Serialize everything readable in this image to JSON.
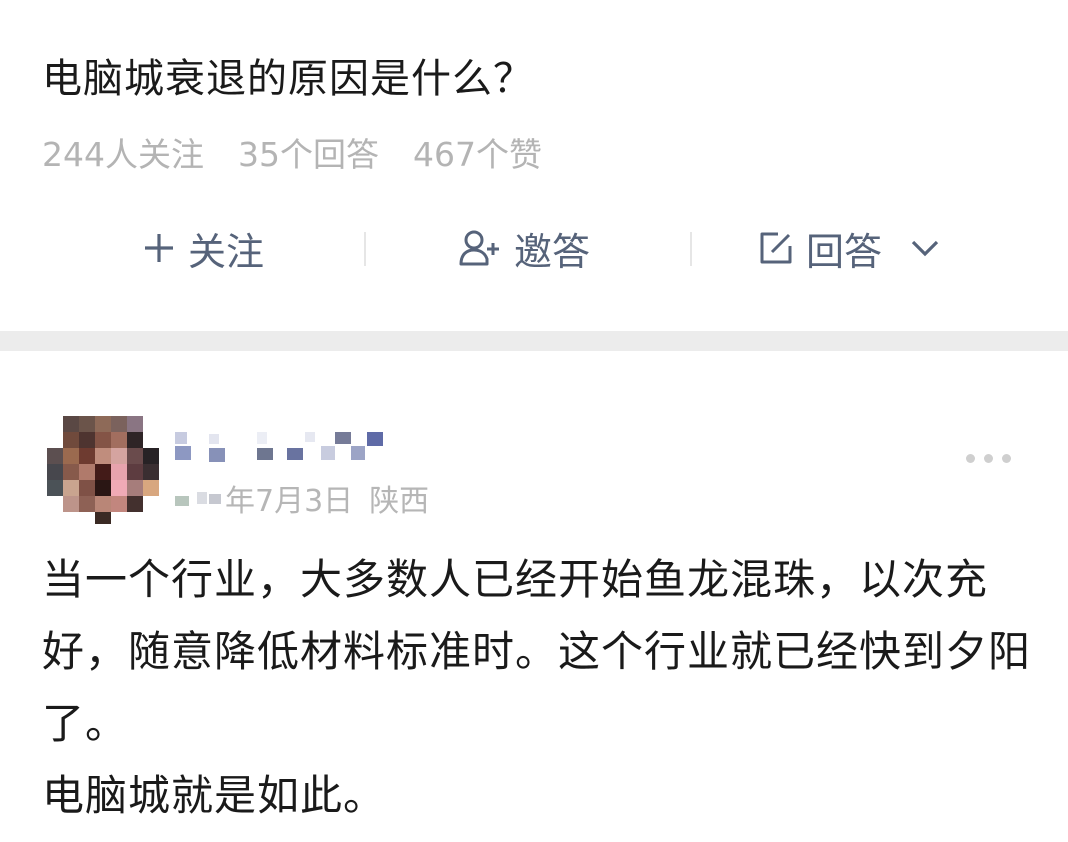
{
  "question": {
    "title": "电脑城衰退的原因是什么？"
  },
  "stats": {
    "followers": "244人关注",
    "answers": "35个回答",
    "likes": "467个赞"
  },
  "actions": {
    "follow_label": "关注",
    "invite_label": "邀答",
    "answer_label": "回答"
  },
  "answer": {
    "meta": {
      "date": "年7月3日",
      "location": "陕西"
    },
    "paragraphs": [
      "当一个行业，大多数人已经开始鱼龙混珠，以次充好，随意降低材料标准时。这个行业就已经快到夕阳了。",
      "电脑城就是如此。"
    ]
  },
  "colors": {
    "accent": "#56637a",
    "muted": "#b4b4b4",
    "band": "#ececec",
    "text": "#1a1a1a"
  }
}
